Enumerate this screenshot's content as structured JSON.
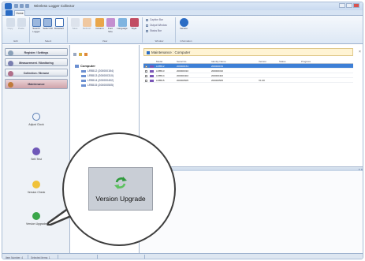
{
  "window": {
    "title": "Wireless Logger Collector"
  },
  "ribbon": {
    "tab_home": "Home",
    "buttons": [
      {
        "label": "Copy"
      },
      {
        "label": "Paste"
      },
      {
        "label": "Search\nLogger"
      },
      {
        "label": "Select\nAll"
      },
      {
        "label": "Deselect"
      },
      {
        "label": "Save"
      },
      {
        "label": "Refresh"
      },
      {
        "label": "Column"
      },
      {
        "label": "Font\nSize"
      },
      {
        "label": "Language"
      },
      {
        "label": "Style"
      },
      {
        "label": "Version"
      }
    ],
    "checks": [
      "Caption Bar",
      "Output Window",
      "Status Bar"
    ],
    "groups": [
      "Edit",
      "Select",
      "View",
      "Window",
      "Information"
    ]
  },
  "nav": {
    "buttons": [
      "Register / Settings",
      "Measurement / Monitoring",
      "Collection / Browse",
      "Maintenance"
    ],
    "tools": [
      "Adjust Clock",
      "Self-Test",
      "Version Check",
      "Version Upgrade"
    ]
  },
  "tree": {
    "root": "Computer",
    "items": [
      "LR8512 (200000154)",
      "LR8513 (200000310)",
      "LR8514 (200000402)",
      "LR8515 (200000505)"
    ]
  },
  "main": {
    "title": "Maintenance : Computer",
    "columns": [
      "Model",
      "Serial No.",
      "Identity Name",
      "Version",
      "Status",
      "Progress"
    ],
    "rows": [
      {
        "model": "LR8512",
        "serial": "200000154",
        "identity": "200000154",
        "version": "",
        "selected": true
      },
      {
        "model": "LR8513",
        "serial": "200000310",
        "identity": "200000310",
        "version": "",
        "selected": false
      },
      {
        "model": "LR8514",
        "serial": "200000402",
        "identity": "200000402",
        "version": "",
        "selected": false
      },
      {
        "model": "LR8515",
        "serial": "200000505",
        "identity": "200000505",
        "version": "V1.00",
        "selected": false
      }
    ]
  },
  "status": {
    "left": "Item Number: 4",
    "mid": "Selected Items: 1"
  },
  "callout": {
    "label": "Version Upgrade"
  },
  "colors": {
    "selection": "#3d7fd6",
    "maintenance_active": "#cfa3aa",
    "header_bg": "#fff4d4"
  }
}
